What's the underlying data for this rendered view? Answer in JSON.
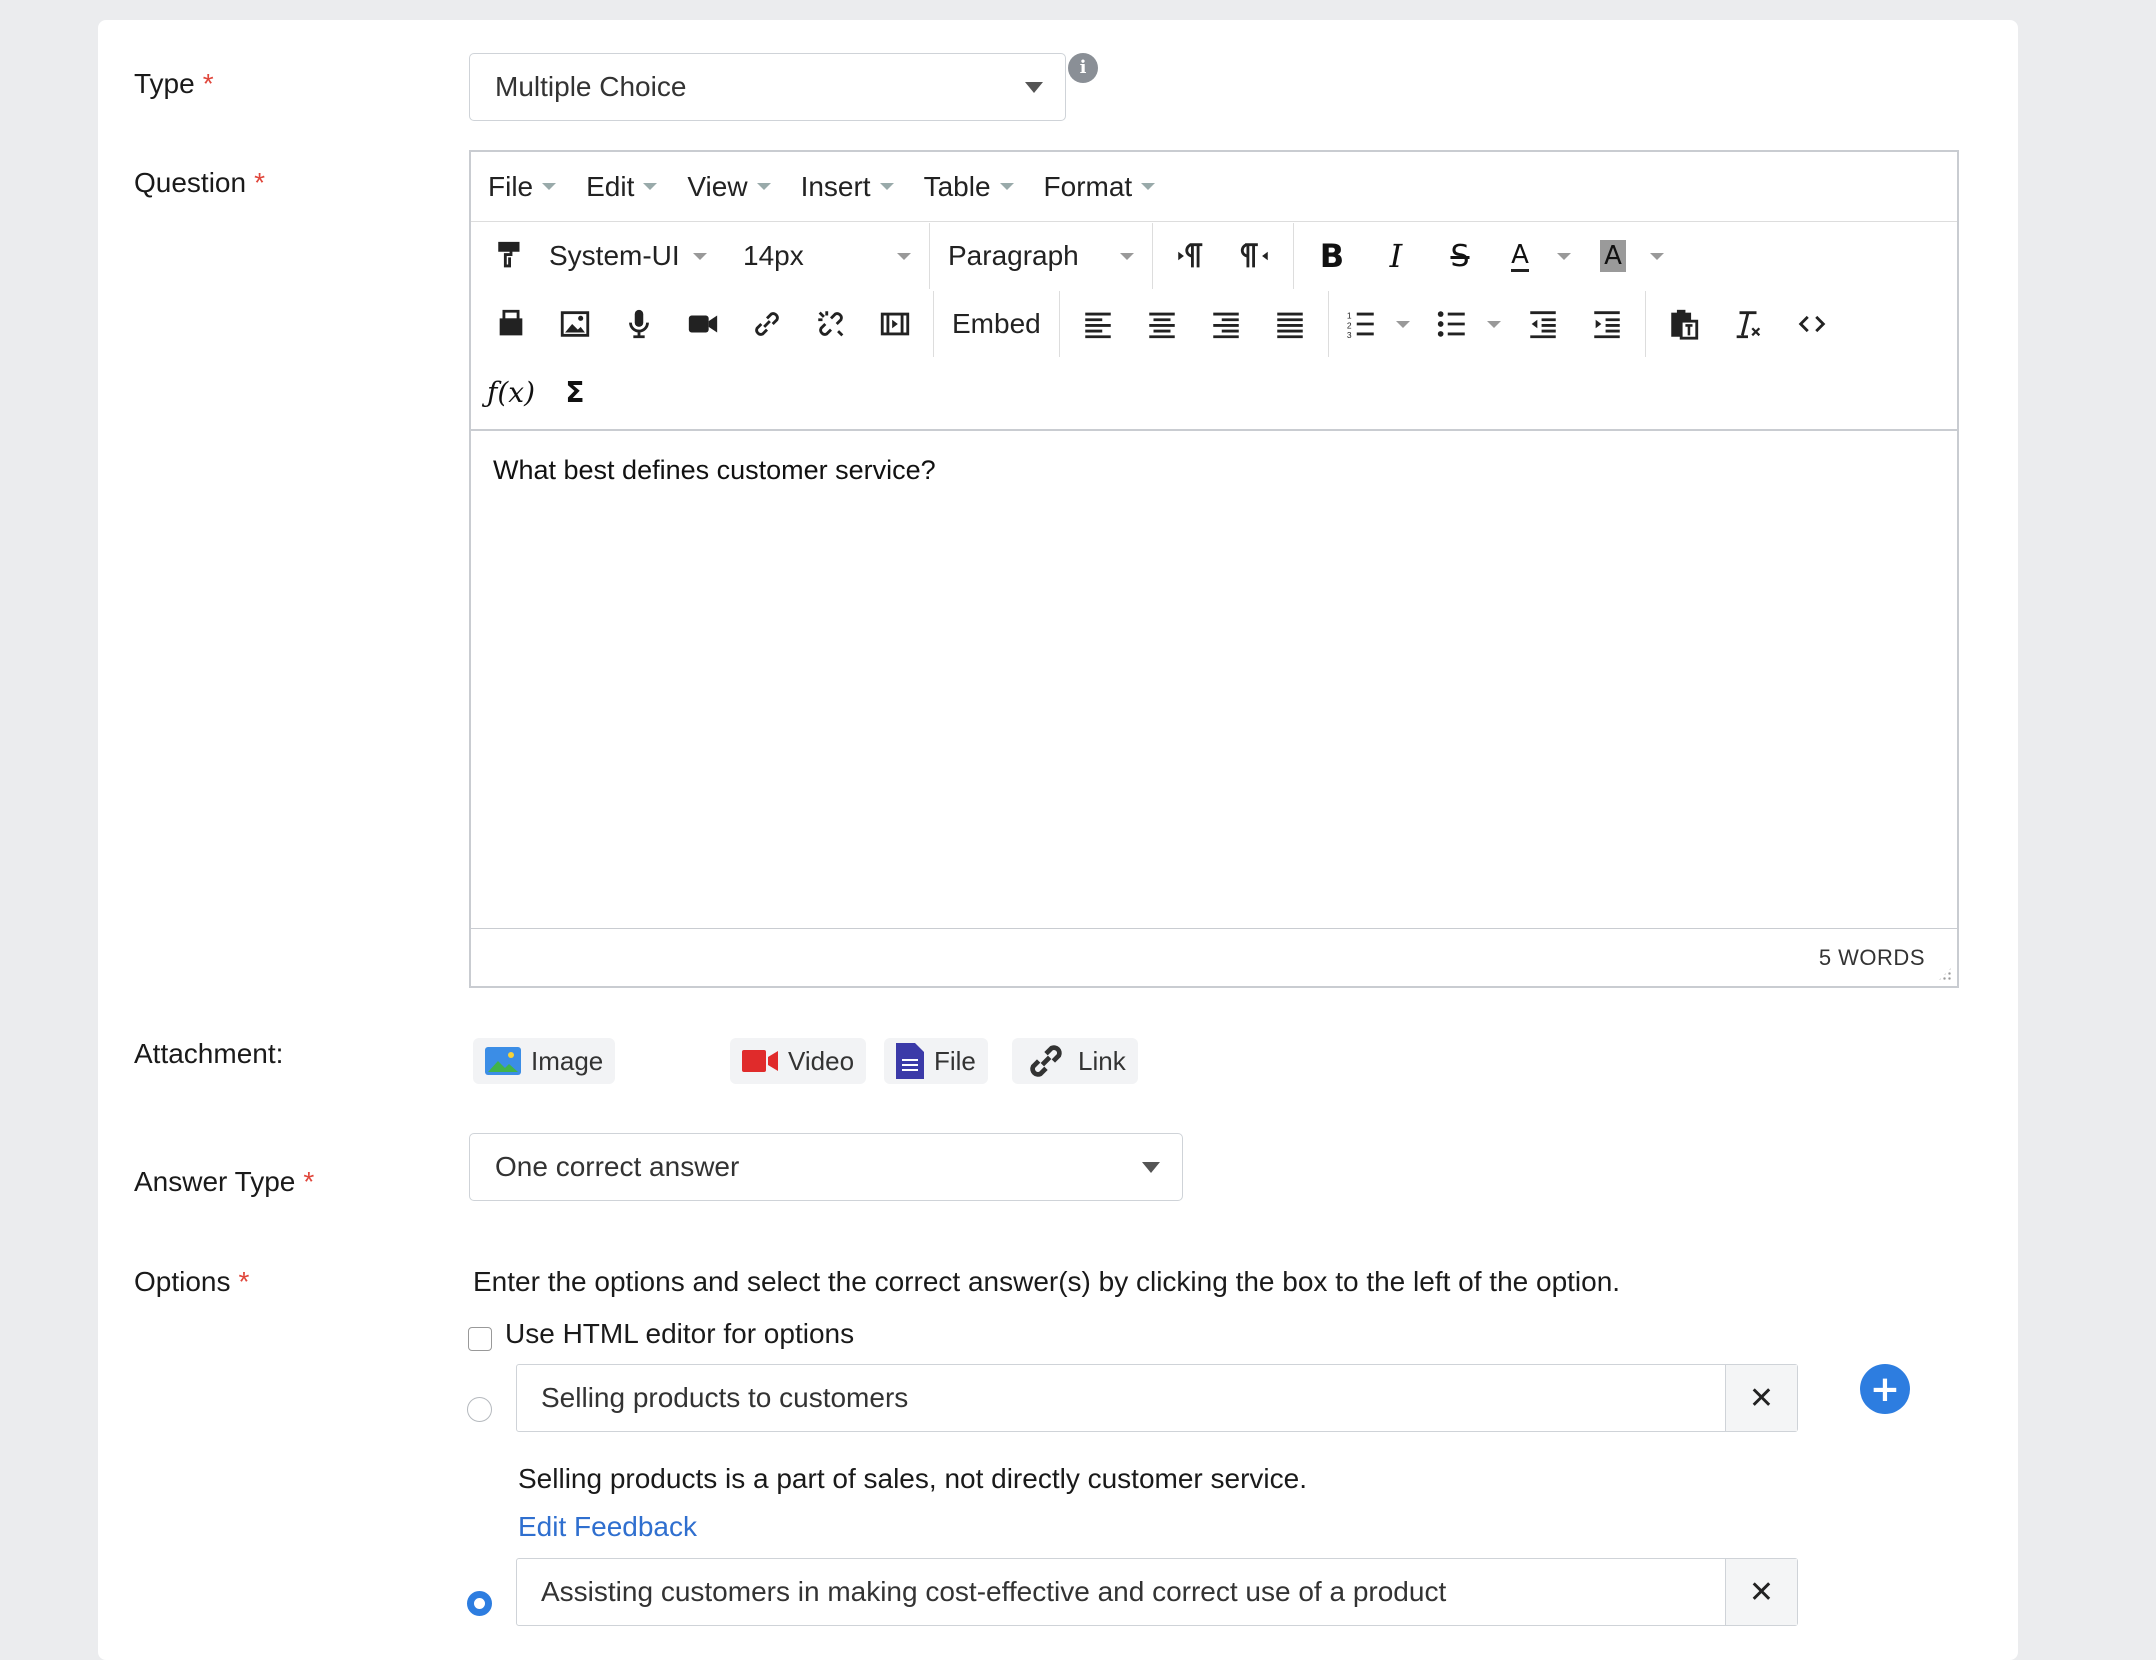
{
  "form": {
    "type_label": "Type",
    "type_value": "Multiple Choice",
    "question_label": "Question",
    "attachment_label": "Attachment:",
    "answer_type_label": "Answer Type",
    "answer_type_value": "One correct answer",
    "options_label": "Options",
    "required_mark": "*",
    "info_glyph": "i"
  },
  "editor": {
    "menu": [
      "File",
      "Edit",
      "View",
      "Insert",
      "Table",
      "Format"
    ],
    "font_family": "System-UI",
    "font_size": "14px",
    "block_format": "Paragraph",
    "embed_label": "Embed",
    "content": "What best defines customer service?",
    "word_count": "5 WORDS"
  },
  "attachments": [
    "Image",
    "Video",
    "File",
    "Link"
  ],
  "options_section": {
    "instructions": "Enter the options and select the correct answer(s) by clicking the box to the left of the option.",
    "html_editor_label": "Use HTML editor for options",
    "items": [
      {
        "text": "Selling products to customers",
        "feedback": "Selling products is a part of sales, not directly customer service.",
        "edit_feedback": "Edit Feedback",
        "correct": false
      },
      {
        "text": "Assisting customers in making cost-effective and correct use of a product",
        "correct": true
      }
    ],
    "remove_glyph": "✕",
    "add_glyph": "+"
  },
  "colors": {
    "accent": "#2d7de0",
    "required": "#e0463b",
    "link": "#2f6fcf"
  }
}
